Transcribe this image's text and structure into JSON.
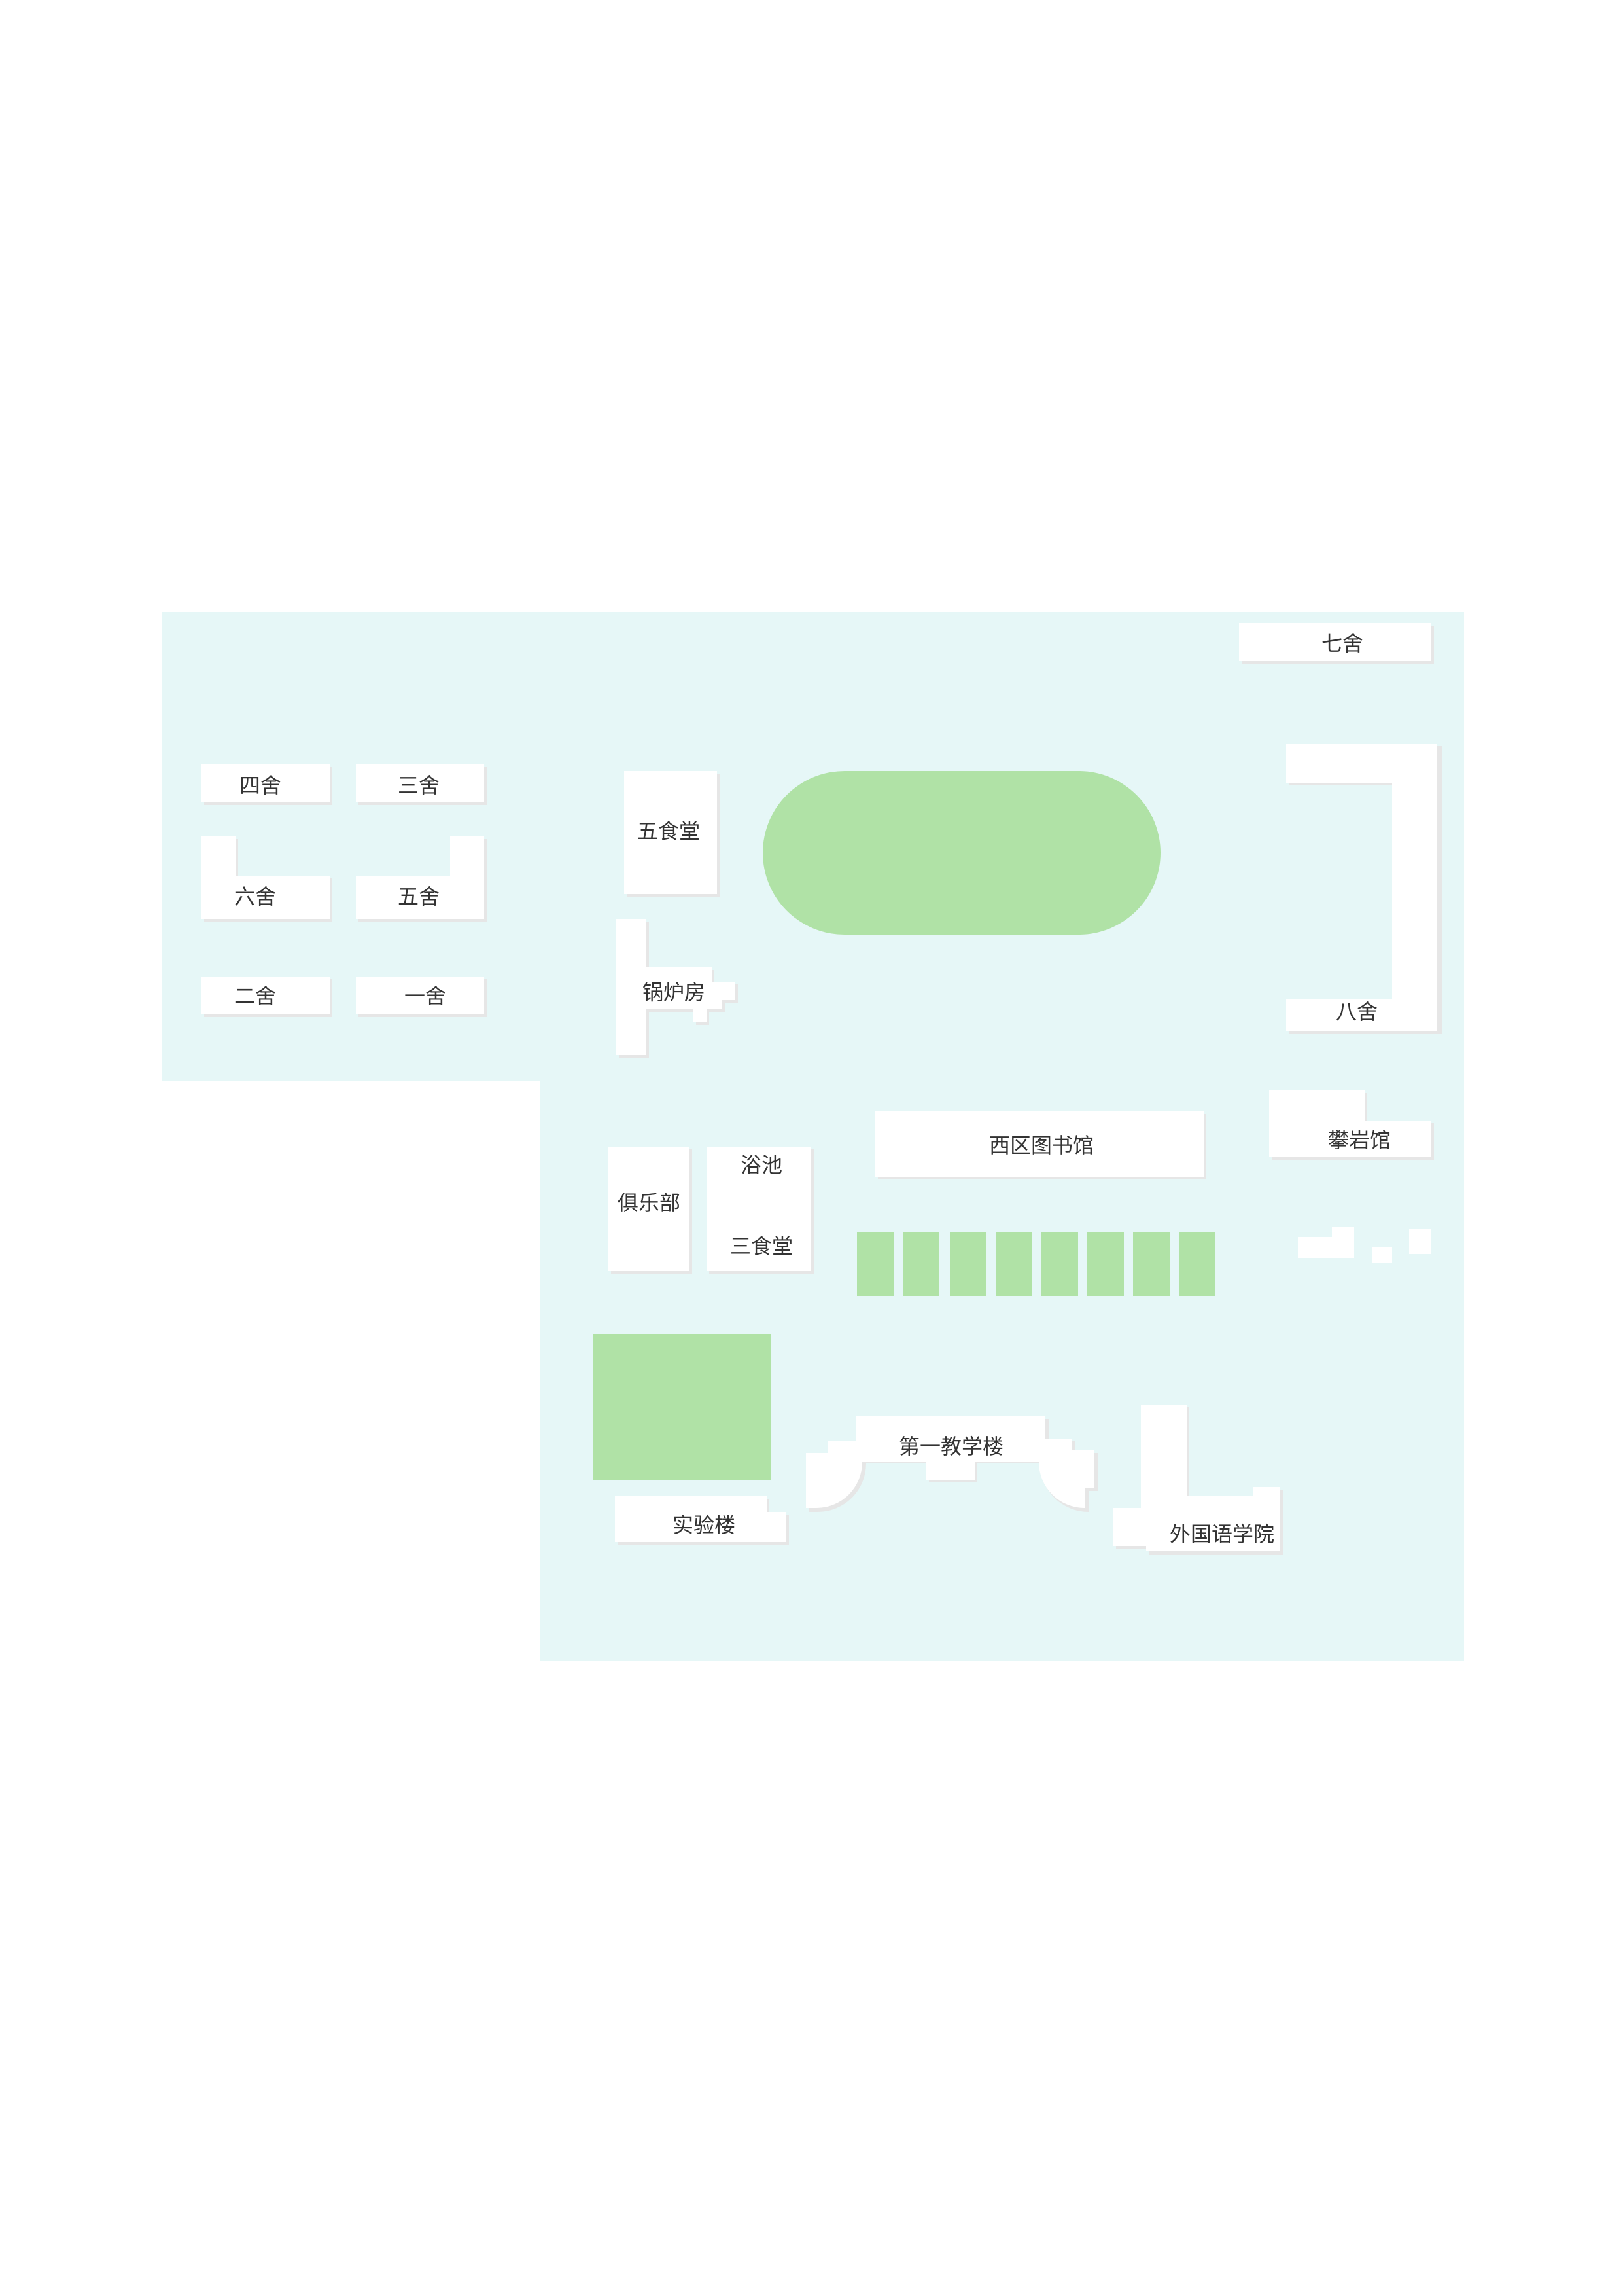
{
  "colors": {
    "page_bg": "#ffffff",
    "campus_bg": "#e6f7f7",
    "building": "#ffffff",
    "building_shadow": "#e6e6e6",
    "green": "#b0e2a6",
    "text": "#333333"
  },
  "labels": {
    "dorm_seven": "七舍",
    "dorm_four": "四舍",
    "dorm_three": "三舍",
    "dorm_six": "六舍",
    "dorm_five": "五舍",
    "dorm_two": "二舍",
    "dorm_one": "一舍",
    "canteen_five": "五食堂",
    "boiler_room": "锅炉房",
    "dorm_eight": "八舍",
    "west_library": "西区图书馆",
    "climbing_hall": "攀岩馆",
    "club": "俱乐部",
    "bathhouse": "浴池",
    "canteen_three": "三食堂",
    "teaching_building_one": "第一教学楼",
    "lab_building": "实验楼",
    "foreign_languages_school": "外国语学院"
  }
}
